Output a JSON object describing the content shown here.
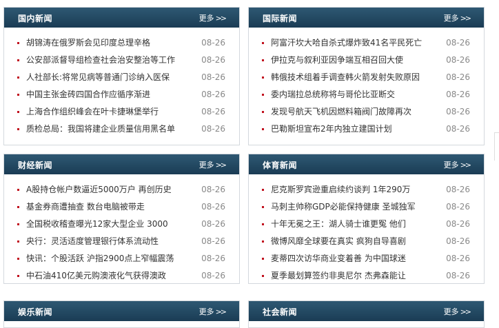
{
  "more_label": "更多",
  "panels": [
    {
      "title": "国内新闻",
      "items": [
        {
          "text": "胡锦涛在俄罗斯会见印度总理辛格",
          "date": "08-26"
        },
        {
          "text": "公安部派督导组检查社会治安整治等工作",
          "date": "08-26"
        },
        {
          "text": "人社部长:将常见病等普通门诊纳入医保",
          "date": "08-26"
        },
        {
          "text": "中国主张金砖四国合作应循序渐进",
          "date": "08-26"
        },
        {
          "text": "上海合作组织峰会在叶卡捷琳堡举行",
          "date": "08-26"
        },
        {
          "text": "质检总局：我国将建企业质量信用黑名单",
          "date": "08-26"
        }
      ]
    },
    {
      "title": "国际新闻",
      "items": [
        {
          "text": "阿富汗坎大哈自杀式爆炸致41名平民死亡",
          "date": "08-26"
        },
        {
          "text": "伊拉克与叙利亚因争端互相召回大使",
          "date": "08-26"
        },
        {
          "text": "韩俄技术组着手调查韩火箭发射失败原因",
          "date": "08-26"
        },
        {
          "text": "委内瑞拉总统称将与哥伦比亚断交",
          "date": "08-26"
        },
        {
          "text": "发现号航天飞机因燃料箱阀门故障再次",
          "date": "08-26"
        },
        {
          "text": "巴勒斯坦宣布2年内独立建国计划",
          "date": "08-26"
        }
      ]
    },
    {
      "title": "财经新闻",
      "items": [
        {
          "text": "A股持仓帐户数逼近5000万户 再创历史",
          "date": "08-26"
        },
        {
          "text": "基金券商遭抽查 数台电脑被带走",
          "date": "08-26"
        },
        {
          "text": "全国税收稽查曝光12家大型企业 3000",
          "date": "08-26"
        },
        {
          "text": "央行：灵活适度管理银行体系流动性",
          "date": "08-26"
        },
        {
          "text": "快讯：个股活跃 沪指2900点上窄幅震荡",
          "date": "08-26"
        },
        {
          "text": "中石油410亿美元购澳液化气获得澳政",
          "date": "08-26"
        }
      ]
    },
    {
      "title": "体育新闻",
      "items": [
        {
          "text": "尼克斯罗宾逊重启续约谈判 1年290万",
          "date": "08-26"
        },
        {
          "text": "马刺主帅称GDP必能保持健康 圣城独军",
          "date": "08-26"
        },
        {
          "text": "十年无冕之王：湖人骑士谁更冤 他们",
          "date": "08-26"
        },
        {
          "text": "微博风靡全球要在真实 疯狗自导喜剧",
          "date": "08-26"
        },
        {
          "text": "麦蒂四次访华商业变着善 为中国球迷",
          "date": "08-26"
        },
        {
          "text": "夏季最划算签约非奥尼尔 杰弗森能让",
          "date": "08-26"
        }
      ]
    },
    {
      "title": "娱乐新闻",
      "items": []
    },
    {
      "title": "社会新闻",
      "items": []
    }
  ]
}
